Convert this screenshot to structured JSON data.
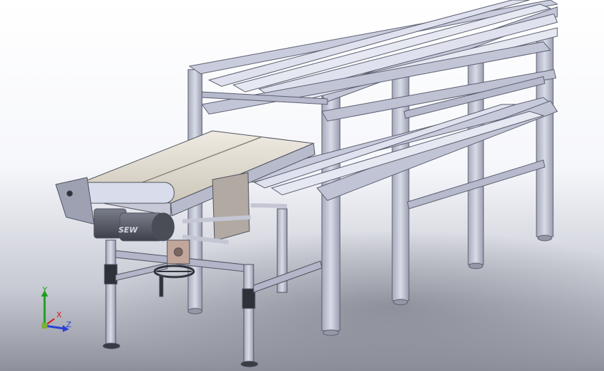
{
  "viewport": {
    "background_top": "#ffffff",
    "background_bottom": "#8d8f9a"
  },
  "model": {
    "frame_color": "#b5b8cb",
    "roller_color": "#d2d6e8",
    "belt_color": "#e6e1d6",
    "motor_color": "#595d68",
    "motor_brand": "SEW"
  },
  "triad": {
    "x_label": "X",
    "y_label": "Y",
    "z_label": "Z",
    "x_color": "#d01c1c",
    "y_color": "#1e9e1e",
    "z_color": "#2b3fd8"
  }
}
